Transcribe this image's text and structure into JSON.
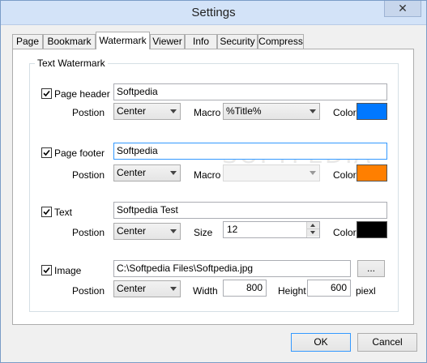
{
  "window": {
    "title": "Settings",
    "close_glyph": "✕"
  },
  "tabs": [
    {
      "label": "Page"
    },
    {
      "label": "Bookmark"
    },
    {
      "label": "Watermark",
      "active": true
    },
    {
      "label": "Viewer"
    },
    {
      "label": "Info"
    },
    {
      "label": "Security"
    },
    {
      "label": "Compress"
    }
  ],
  "group": {
    "label": "Text Watermark"
  },
  "header": {
    "check_label": "Page header",
    "checked": true,
    "text": "Softpedia",
    "position_label": "Postion",
    "position_value": "Center",
    "macro_label": "Macro",
    "macro_value": "%Title%",
    "color_label": "Color",
    "color": "#0078ff"
  },
  "footer": {
    "check_label": "Page footer",
    "checked": true,
    "text": "Softpedia",
    "position_label": "Postion",
    "position_value": "Center",
    "macro_label": "Macro",
    "macro_value": "",
    "color_label": "Color",
    "color": "#ff7f00"
  },
  "text": {
    "check_label": "Text",
    "checked": true,
    "text": "Softpedia Test",
    "position_label": "Postion",
    "position_value": "Center",
    "size_label": "Size",
    "size_value": "12",
    "color_label": "Color",
    "color": "#000000"
  },
  "image": {
    "check_label": "Image",
    "checked": true,
    "path": "C:\\Softpedia Files\\Softpedia.jpg",
    "browse_label": "...",
    "position_label": "Postion",
    "position_value": "Center",
    "width_label": "Width",
    "width_value": "800",
    "height_label": "Height",
    "height_value": "600",
    "unit_label": "piexl"
  },
  "footer_buttons": {
    "ok": "OK",
    "cancel": "Cancel"
  },
  "background_watermark": "SOFTPEDIA"
}
